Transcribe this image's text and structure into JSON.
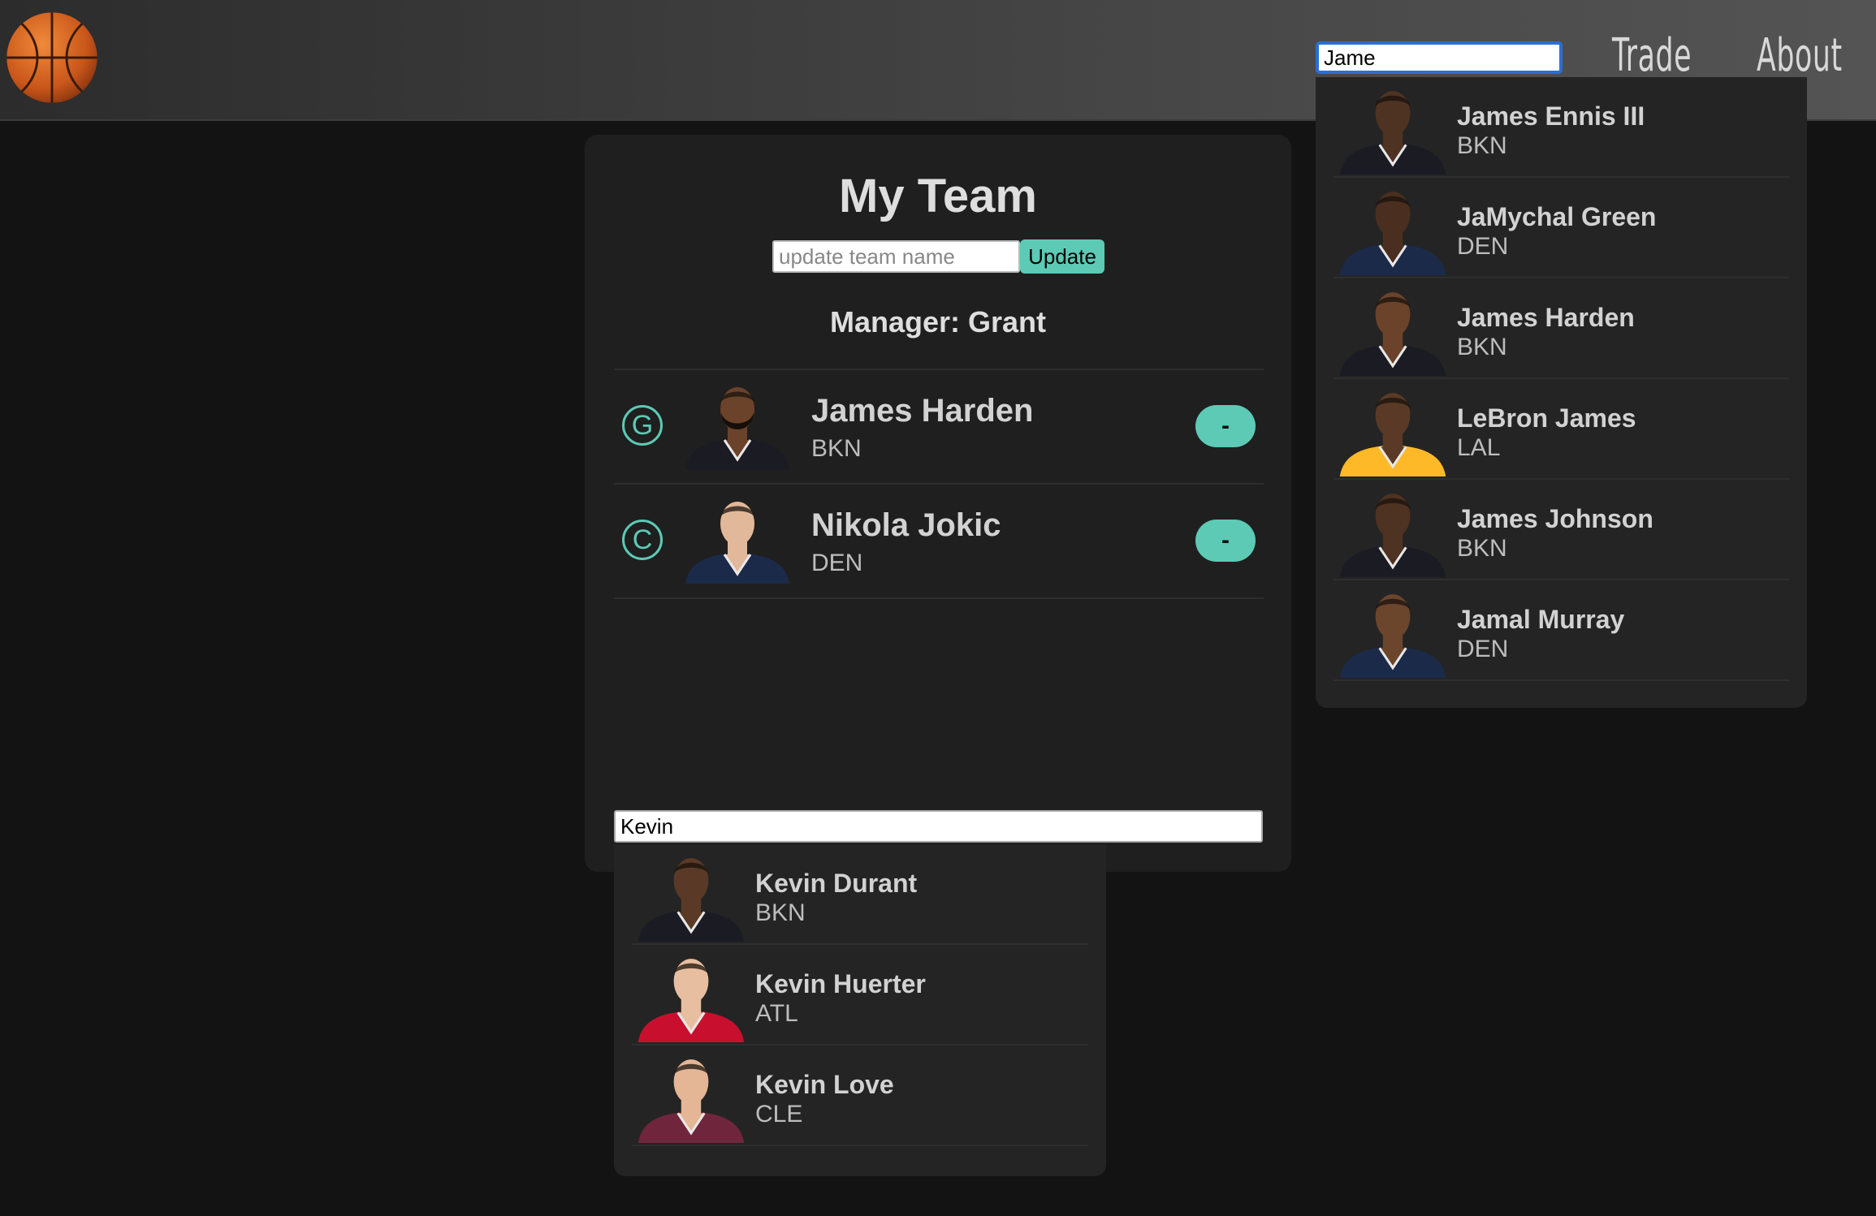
{
  "nav": {
    "search_value": "Jame",
    "links": [
      "Trade",
      "About"
    ]
  },
  "team": {
    "title": "My Team",
    "name_placeholder": "update team name",
    "update_label": "Update",
    "manager_label": "Manager: Grant",
    "remove_label": "-",
    "roster": [
      {
        "position": "G",
        "name": "James Harden",
        "team": "BKN",
        "skin": "#6b432a",
        "jersey": "#1b1b24",
        "beard": true
      },
      {
        "position": "C",
        "name": "Nikola Jokic",
        "team": "DEN",
        "skin": "#e2b89a",
        "jersey": "#1c2a4a",
        "beard": false
      }
    ]
  },
  "add_player": {
    "search_value": "Kevin",
    "results": [
      {
        "name": "Kevin Durant",
        "team": "BKN",
        "skin": "#5a3a26",
        "jersey": "#1b1b24"
      },
      {
        "name": "Kevin Huerter",
        "team": "ATL",
        "skin": "#e8bea0",
        "jersey": "#c8102e"
      },
      {
        "name": "Kevin Love",
        "team": "CLE",
        "skin": "#e4b696",
        "jersey": "#6f263d"
      }
    ]
  },
  "nav_results": [
    {
      "name": "James Ennis III",
      "team": "BKN",
      "skin": "#4e3222",
      "jersey": "#1b1b24"
    },
    {
      "name": "JaMychal Green",
      "team": "DEN",
      "skin": "#4a2f20",
      "jersey": "#1c2a4a"
    },
    {
      "name": "James Harden",
      "team": "BKN",
      "skin": "#6b432a",
      "jersey": "#1b1b24"
    },
    {
      "name": "LeBron James",
      "team": "LAL",
      "skin": "#5a3a26",
      "jersey": "#fdb927"
    },
    {
      "name": "James Johnson",
      "team": "BKN",
      "skin": "#4e3222",
      "jersey": "#1b1b24"
    },
    {
      "name": "Jamal Murray",
      "team": "DEN",
      "skin": "#6b452c",
      "jersey": "#1c2a4a"
    }
  ],
  "colors": {
    "accent": "#5dcab5",
    "background": "#131313",
    "card": "#1f1f1f",
    "dropdown": "#242424"
  }
}
